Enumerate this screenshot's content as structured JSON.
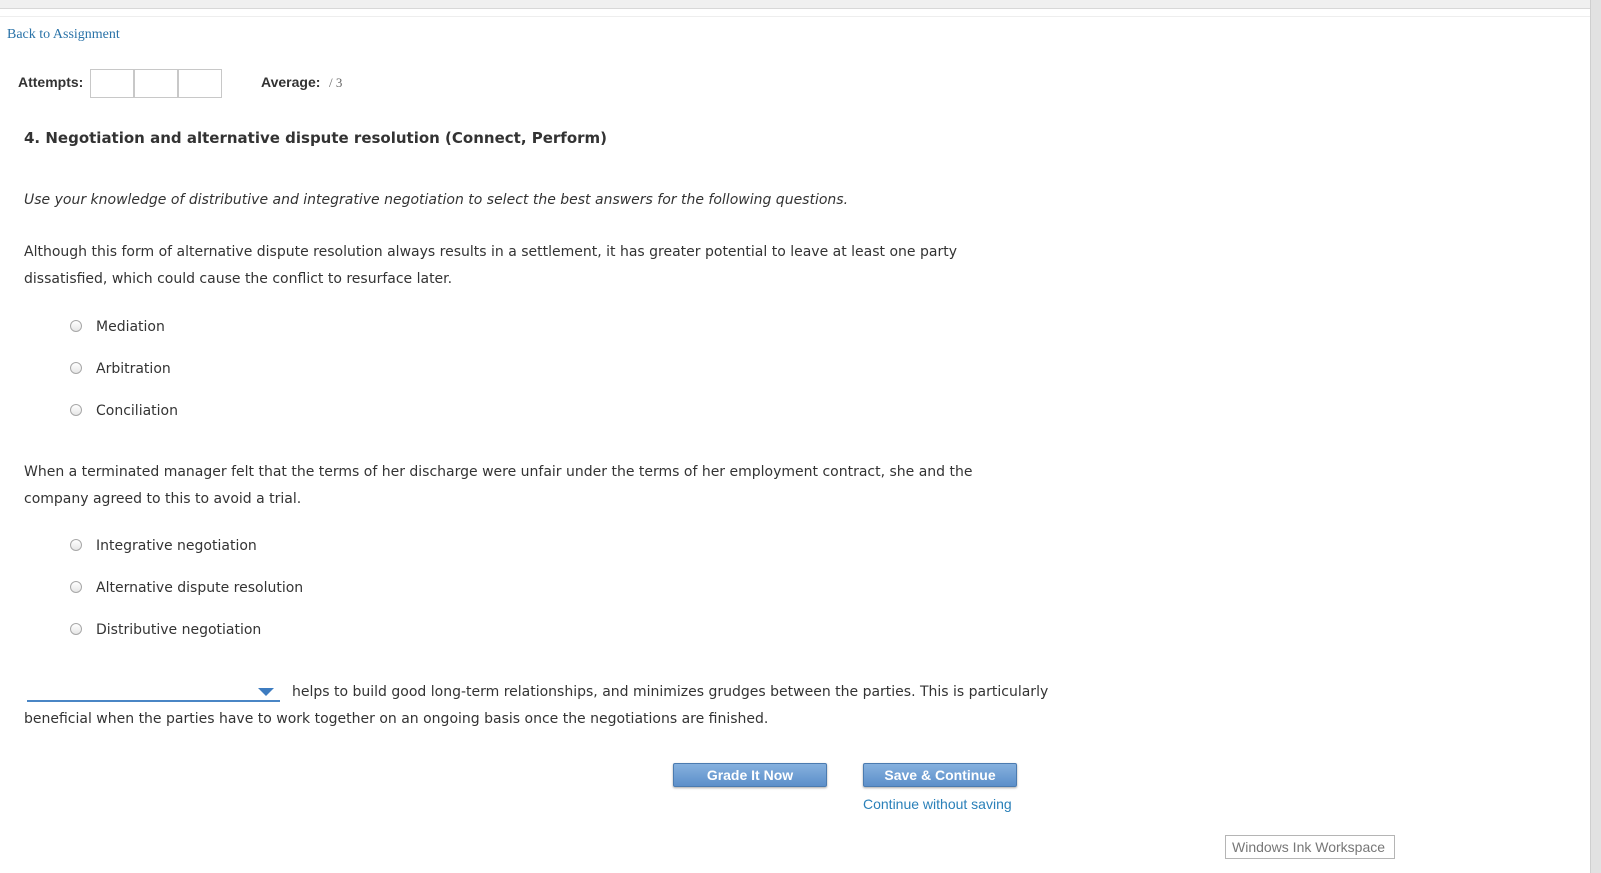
{
  "nav": {
    "back_link": "Back to Assignment"
  },
  "header": {
    "attempts_label": "Attempts:",
    "attempts": [
      "",
      "",
      ""
    ],
    "average_label": "Average:",
    "average_value": "/ 3"
  },
  "question": {
    "title": "4. Negotiation and alternative dispute resolution (Connect, Perform)",
    "instructions": "Use your knowledge of distributive and integrative negotiation to select the best answers for the following questions.",
    "part1": {
      "text": "Although this form of alternative dispute resolution always results in a settlement, it has greater potential to leave at least one party dissatisfied, which could cause the conflict to resurface later.",
      "options": [
        "Mediation",
        "Arbitration",
        "Conciliation"
      ]
    },
    "part2": {
      "text": "When a terminated manager felt that the terms of her discharge were unfair under the terms of her employment contract, she and the company agreed to this to avoid a trial.",
      "options": [
        "Integrative negotiation",
        "Alternative dispute resolution",
        "Distributive negotiation"
      ]
    },
    "part3": {
      "selected": "",
      "text_line1": "helps to build good long-term relationships, and minimizes grudges between the parties. This is particularly",
      "text_line2": "beneficial when the parties have to work together on an ongoing basis once the negotiations are finished."
    }
  },
  "actions": {
    "grade_button": "Grade It Now",
    "save_button": "Save & Continue",
    "continue_link": "Continue without saving"
  },
  "overlay": {
    "ink_workspace": "Windows Ink Workspace"
  },
  "colors": {
    "link": "#2a73a8",
    "button": "#6b9bd2",
    "dropdown_accent": "#3d7cc0"
  }
}
